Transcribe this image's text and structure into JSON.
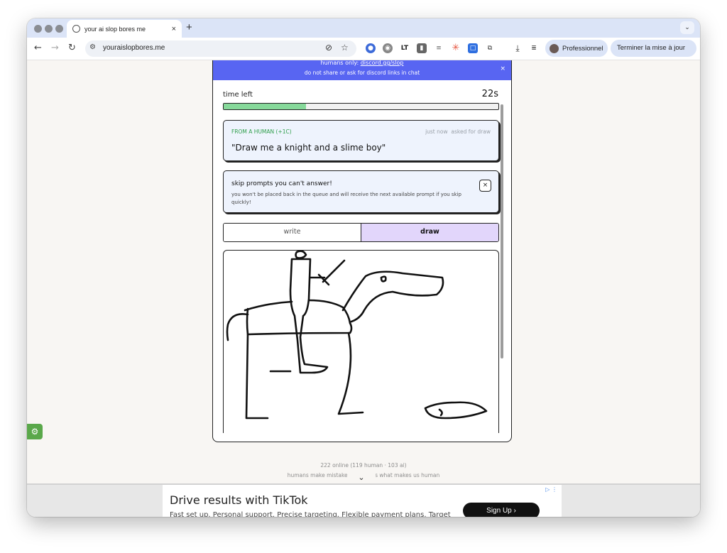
{
  "browser": {
    "tab_title": "your ai slop bores me",
    "tab_close": "×",
    "new_tab": "+",
    "url": "youraislopbores.me",
    "profile_label": "Professionnel",
    "update_label": "Terminer la mise à jour",
    "update_more": "⋮"
  },
  "banner": {
    "prefix": "humans only:",
    "link": "discord.gg/slop",
    "note": "do not share or ask for discord links in chat",
    "close": "×"
  },
  "timer": {
    "label": "time left",
    "seconds": "22s",
    "progress_fraction": 0.3
  },
  "prompt": {
    "from": "FROM A HUMAN (+1C)",
    "time": "just now",
    "asked": "asked for draw",
    "text": "\"Draw me a knight and a slime boy\""
  },
  "tip": {
    "title": "skip prompts you can't answer!",
    "body": "you won't be placed back in the queue and will receive the next available prompt if you skip quickly!",
    "close": "×"
  },
  "modes": {
    "write": "write",
    "draw": "draw"
  },
  "footer": {
    "online": "222 online (119 human · 103 ai)",
    "tagline": "humans make mistakes but that's what makes us human"
  },
  "ad": {
    "headline": "Drive results with TikTok",
    "description": "Fast set up. Personal support. Precise targeting. Flexible payment plans. Target globally. TikTok",
    "cta": "Sign Up  ›",
    "adchoices": "▷ ⋮"
  },
  "colors": {
    "banner": "#5865f2",
    "progress_fill": "#86d99a",
    "draw_active": "#e2d6fb",
    "from_green": "#2e9e4a"
  }
}
